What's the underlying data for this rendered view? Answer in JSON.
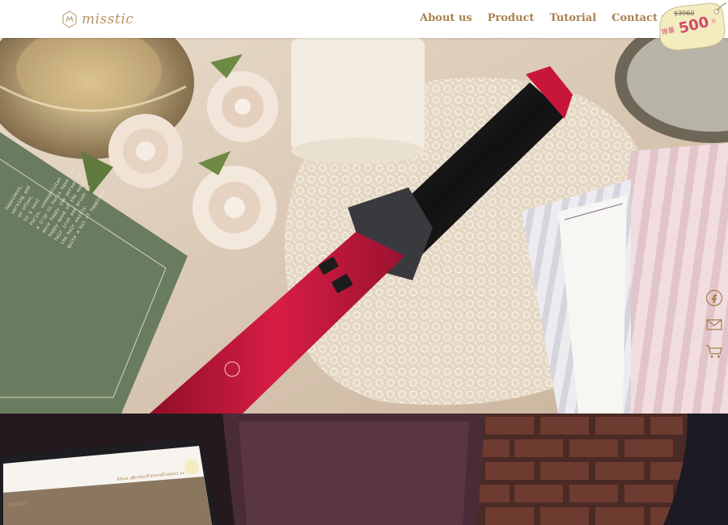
{
  "header": {
    "logo_text": "misstic",
    "nav": [
      "About us",
      "Product",
      "Tutorial",
      "Contact us"
    ]
  },
  "promo_tag": {
    "original_price": "$3960",
    "prefix": "限量",
    "price": "500",
    "suffix": "元"
  },
  "side_icons": [
    "facebook-icon",
    "mail-icon",
    "cart-icon"
  ],
  "hero": {
    "book_text": [
      "happiness,",
      "working and",
      "so often,",
      "to a seat",
      "Paris, cosmopolitan",
      "a trip to Paris have just.",
      "more happy the person we",
      "happy mood of the sweet",
      "hair iron and brush to",
      "the hair easily.",
      "quite a bit of happiness."
    ]
  },
  "mini_screen": {
    "logo_text": "misstic",
    "nav": [
      "About us",
      "Product",
      "Tutorial",
      "Contact us"
    ]
  },
  "colors": {
    "brand_gold": "#a9814e",
    "accent_pink": "#d24b6c",
    "iron_red": "#c8163a"
  }
}
